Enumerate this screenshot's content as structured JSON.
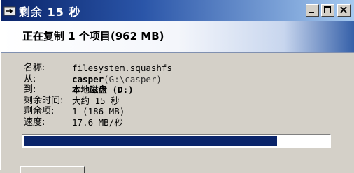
{
  "window": {
    "title": "剩余 15 秒"
  },
  "header": {
    "status": "正在复制 1 个项目(962 MB)"
  },
  "details": {
    "name_label": "名称:",
    "name_value": "filesystem.squashfs",
    "from_label": "从:",
    "from_value": "casper",
    "from_path": "(G:\\casper)",
    "to_label": "到:",
    "to_value": "本地磁盘 (D:)",
    "time_label": "剩余时间:",
    "time_value": "大约 15 秒",
    "items_label": "剩余项:",
    "items_value": "1 (186 MB)",
    "speed_label": "速度:",
    "speed_value": "17.6 MB/秒"
  },
  "progress": {
    "fraction": 0.83
  },
  "icons": [
    "copy-app-icon",
    "minimize-icon",
    "maximize-icon",
    "close-icon"
  ],
  "colors": {
    "title_bar": "#0a246a",
    "progress_fill": "#0a246a",
    "background": "#d4d0c8"
  }
}
